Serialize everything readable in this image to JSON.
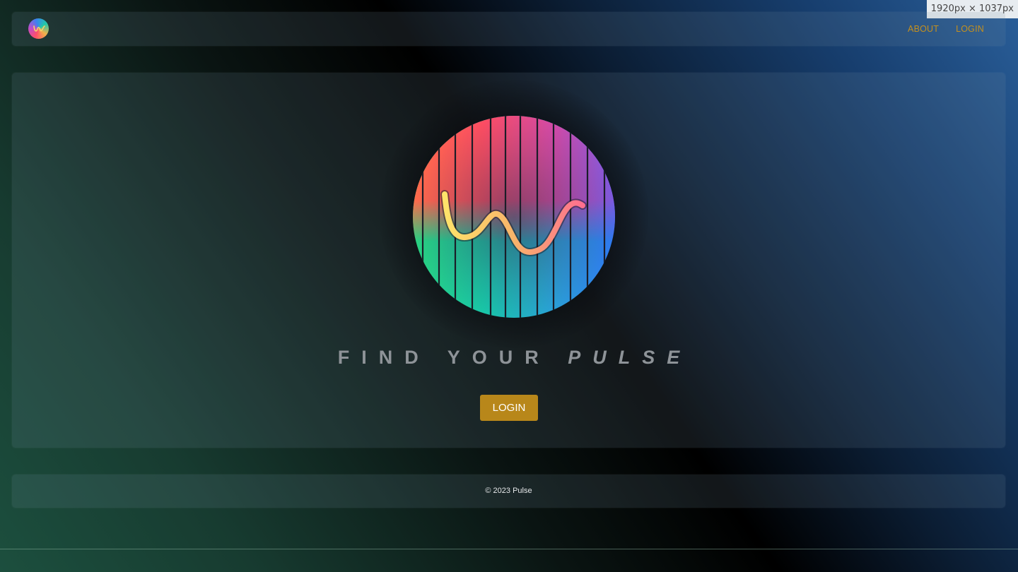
{
  "nav": {
    "logo_icon": "pulse-wave-logo-icon",
    "links": [
      {
        "label": "ABOUT"
      },
      {
        "label": "LOGIN"
      }
    ],
    "link_color": "#c4901e"
  },
  "hero": {
    "logo_icon": "pulse-wave-logo-icon",
    "tagline_main": "FIND YOUR ",
    "tagline_accent": "PULSE",
    "login_label": "LOGIN",
    "button_color": "#b8871a"
  },
  "footer": {
    "copyright": "© 2023 Pulse"
  },
  "viewport_badge": "1920px × 1037px"
}
